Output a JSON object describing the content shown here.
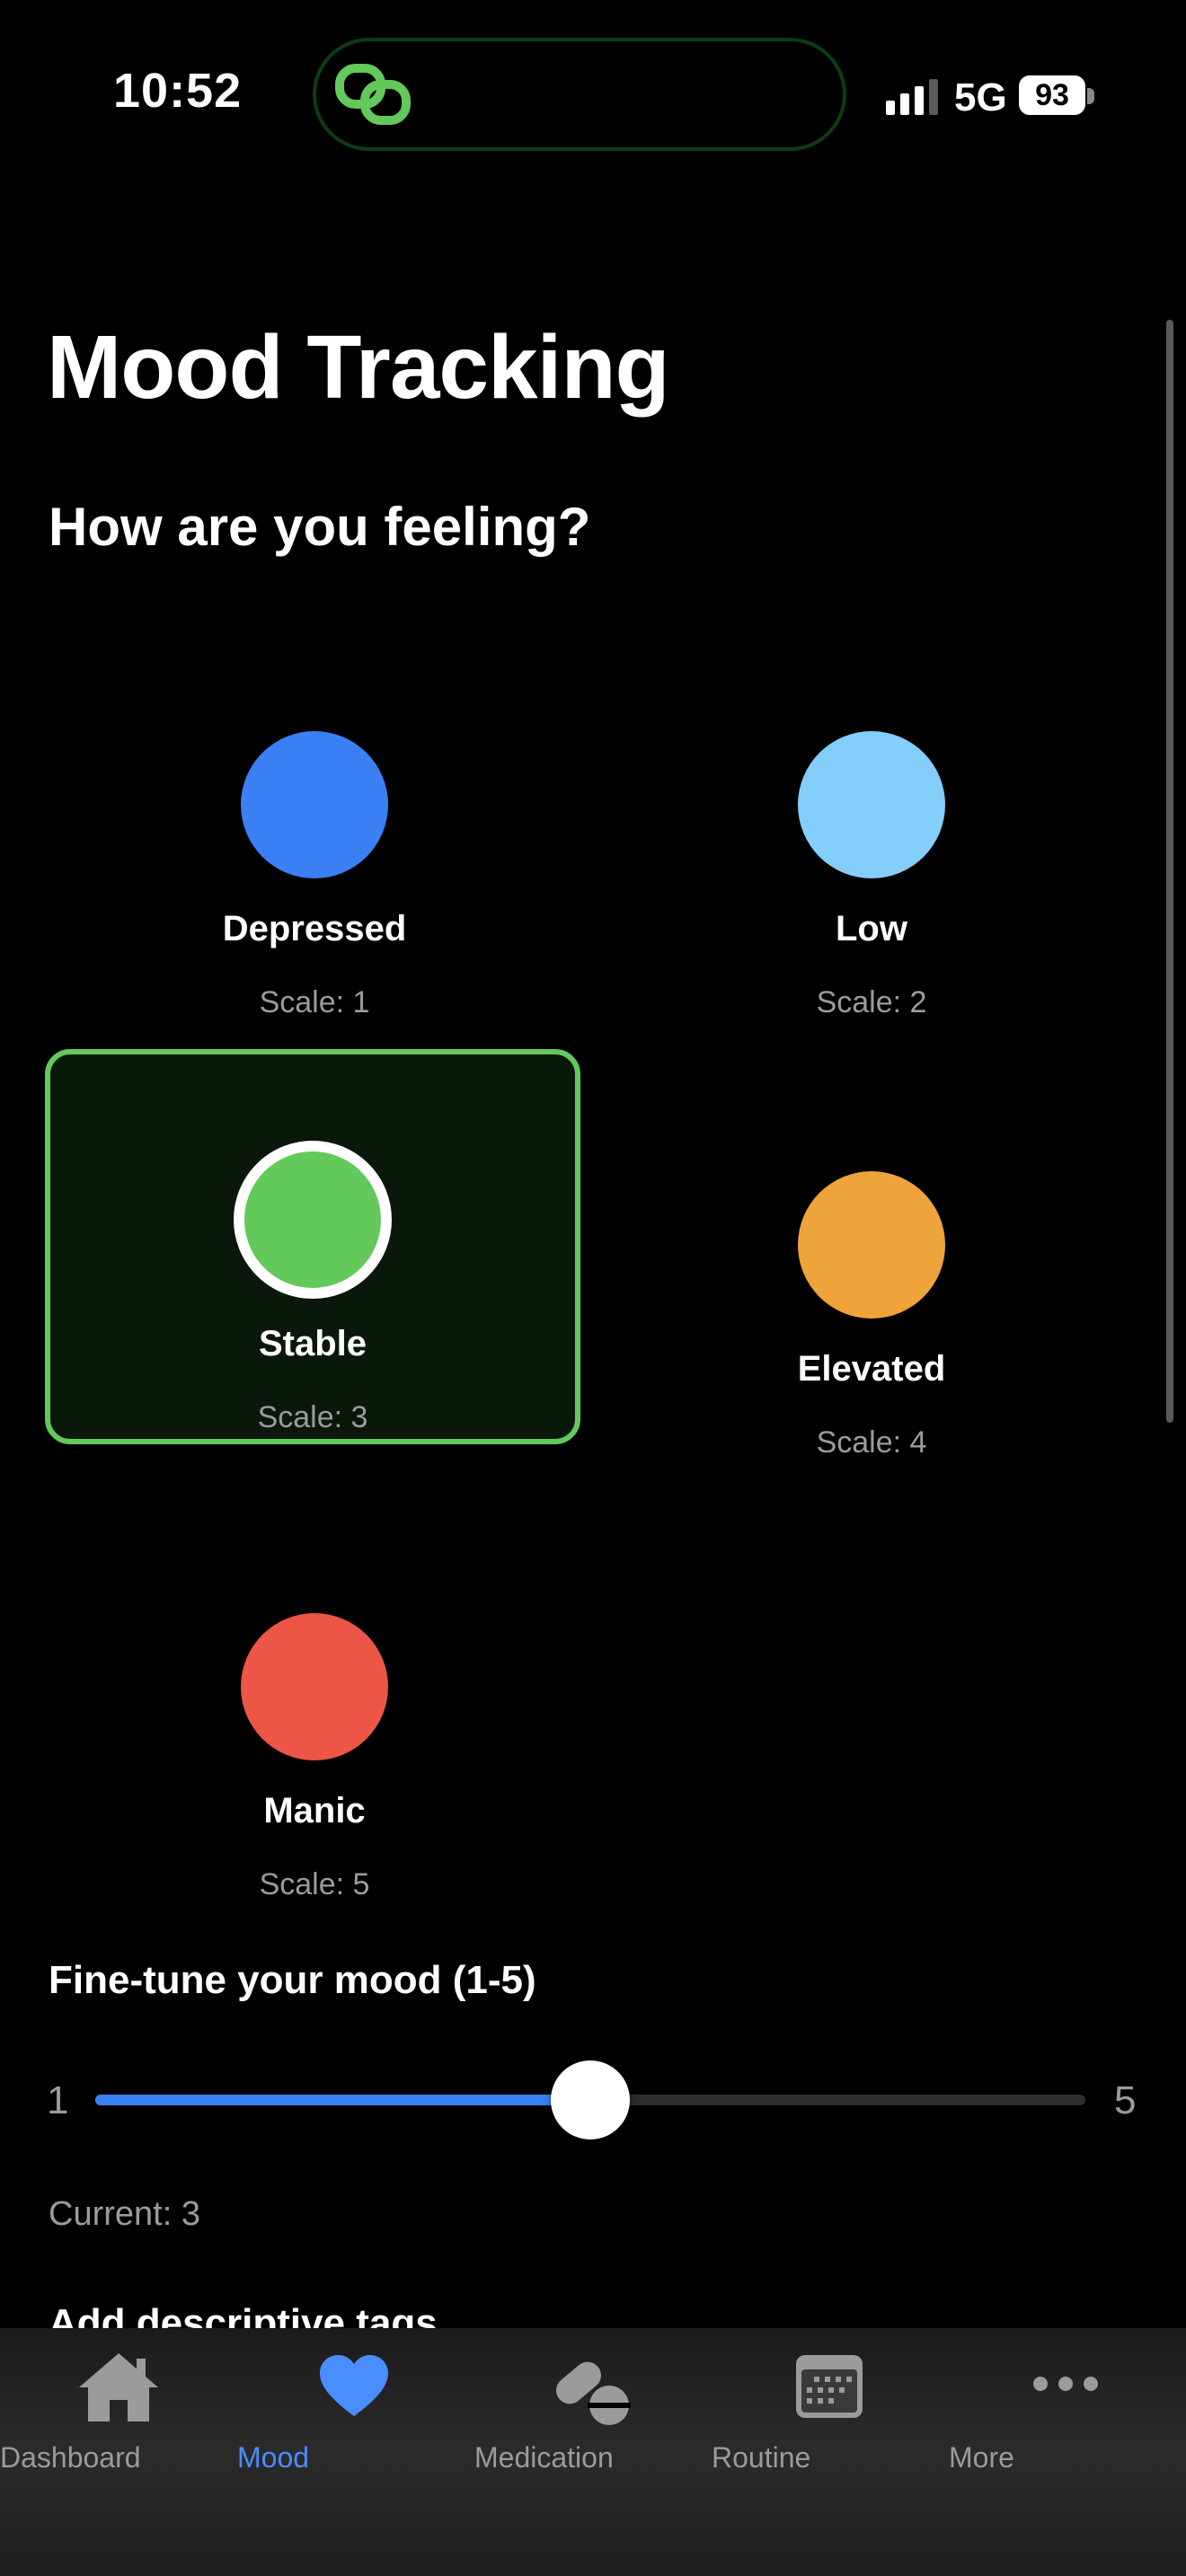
{
  "status_bar": {
    "time": "10:52",
    "network": "5G",
    "battery": "93",
    "icons": [
      "app-link-icon",
      "signal-icon",
      "battery-icon"
    ]
  },
  "page": {
    "title": "Mood Tracking",
    "section_heading": "How are you feeling?"
  },
  "moods": [
    {
      "label": "Depressed",
      "scale": "Scale: 1",
      "color": "#3b7ff5",
      "selected": false
    },
    {
      "label": "Low",
      "scale": "Scale: 2",
      "color": "#84cefb",
      "selected": false
    },
    {
      "label": "Stable",
      "scale": "Scale: 3",
      "color": "#62c95a",
      "selected": true
    },
    {
      "label": "Elevated",
      "scale": "Scale: 4",
      "color": "#efa33b",
      "selected": false
    },
    {
      "label": "Manic",
      "scale": "Scale: 5",
      "color": "#ed5546",
      "selected": false
    }
  ],
  "slider": {
    "heading": "Fine-tune your mood (1-5)",
    "min_label": "1",
    "max_label": "5",
    "min": 1,
    "max": 5,
    "value": 3,
    "current_text": "Current: 3",
    "accent": "#3b82f6"
  },
  "next_section": {
    "heading": "Add descriptive tags"
  },
  "tab_bar": {
    "active_color": "#4a8dff",
    "inactive_color": "#9b9b9b",
    "tabs": [
      {
        "label": "Dashboard",
        "icon": "house-icon",
        "active": false
      },
      {
        "label": "Mood",
        "icon": "heart-icon",
        "active": true
      },
      {
        "label": "Medication",
        "icon": "pills-icon",
        "active": false
      },
      {
        "label": "Routine",
        "icon": "calendar-icon",
        "active": false
      },
      {
        "label": "More",
        "icon": "ellipsis-icon",
        "active": false
      }
    ]
  }
}
